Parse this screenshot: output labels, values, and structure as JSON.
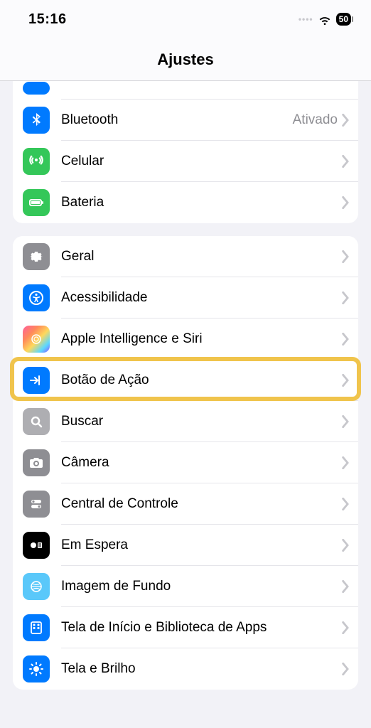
{
  "status": {
    "time": "15:16",
    "battery": "50"
  },
  "header": {
    "title": "Ajustes"
  },
  "groups": [
    {
      "rows": [
        {
          "label": "",
          "value": "",
          "icon": "plane"
        },
        {
          "label": "Bluetooth",
          "value": "Ativado",
          "icon": "bluetooth"
        },
        {
          "label": "Celular",
          "value": "",
          "icon": "cellular"
        },
        {
          "label": "Bateria",
          "value": "",
          "icon": "battery"
        }
      ]
    },
    {
      "rows": [
        {
          "label": "Geral",
          "icon": "gear"
        },
        {
          "label": "Acessibilidade",
          "icon": "accessibility"
        },
        {
          "label": "Apple Intelligence e Siri",
          "icon": "siri"
        },
        {
          "label": "Botão de Ação",
          "icon": "action"
        },
        {
          "label": "Buscar",
          "icon": "search"
        },
        {
          "label": "Câmera",
          "icon": "camera"
        },
        {
          "label": "Central de Controle",
          "icon": "controlcenter"
        },
        {
          "label": "Em Espera",
          "icon": "standby"
        },
        {
          "label": "Imagem de Fundo",
          "icon": "wallpaper"
        },
        {
          "label": "Tela de Início e Biblioteca de Apps",
          "icon": "homescreen"
        },
        {
          "label": "Tela e Brilho",
          "icon": "brightness"
        }
      ]
    }
  ]
}
